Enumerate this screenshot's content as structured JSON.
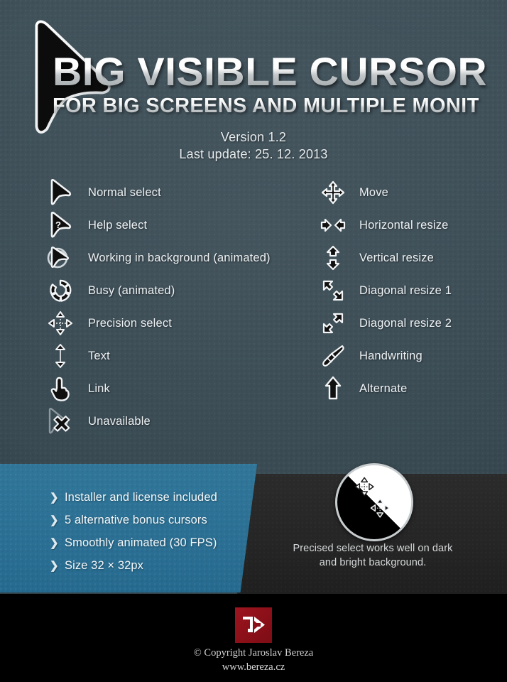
{
  "header": {
    "title": "BIG VISIBLE CURSORS",
    "subtitle": "FOR BIG SCREENS AND MULTIPLE MONITORS",
    "version": "Version 1.2",
    "last_update": "Last update: 25. 12. 2013",
    "logo_icon": "big-cursor-arrow-icon"
  },
  "cursors": {
    "left_column": [
      {
        "icon": "normal-select-cursor-icon",
        "label": "Normal select"
      },
      {
        "icon": "help-select-cursor-icon",
        "label": "Help select"
      },
      {
        "icon": "working-in-background-cursor-icon",
        "label": "Working in background (animated)"
      },
      {
        "icon": "busy-cursor-icon",
        "label": "Busy (animated)"
      },
      {
        "icon": "precision-select-cursor-icon",
        "label": "Precision select"
      },
      {
        "icon": "text-cursor-icon",
        "label": "Text"
      },
      {
        "icon": "link-hand-cursor-icon",
        "label": "Link"
      },
      {
        "icon": "unavailable-cursor-icon",
        "label": "Unavailable"
      }
    ],
    "right_column": [
      {
        "icon": "move-cursor-icon",
        "label": "Move"
      },
      {
        "icon": "horizontal-resize-cursor-icon",
        "label": "Horizontal resize"
      },
      {
        "icon": "vertical-resize-cursor-icon",
        "label": "Vertical resize"
      },
      {
        "icon": "diagonal-resize-1-cursor-icon",
        "label": "Diagonal resize 1"
      },
      {
        "icon": "diagonal-resize-2-cursor-icon",
        "label": "Diagonal resize 2"
      },
      {
        "icon": "handwriting-pen-cursor-icon",
        "label": "Handwriting"
      },
      {
        "icon": "alternate-arrow-cursor-icon",
        "label": "Alternate"
      }
    ]
  },
  "features": {
    "bullet_icon": "chevron-right-icon",
    "items": [
      "Installer and license included",
      "5 alternative bonus cursors",
      "Smoothly animated (30 FPS)",
      "Size 32 × 32px"
    ]
  },
  "demo": {
    "icon": "precision-select-on-split-background-icon",
    "caption_line1": "Precised select works well on dark",
    "caption_line2": "and bright background."
  },
  "footer": {
    "logo_icon": "jb-monogram-logo",
    "logo_text": "JB",
    "copyright": "© Copyright Jaroslav Bereza",
    "website": "www.bereza.cz"
  },
  "colors": {
    "background_slate": "#3d4e57",
    "panel_blue": "#2c7295",
    "panel_dark": "#262626",
    "footer_black": "#000000",
    "logo_red": "#8d1019",
    "text_light": "#eef2f4"
  }
}
